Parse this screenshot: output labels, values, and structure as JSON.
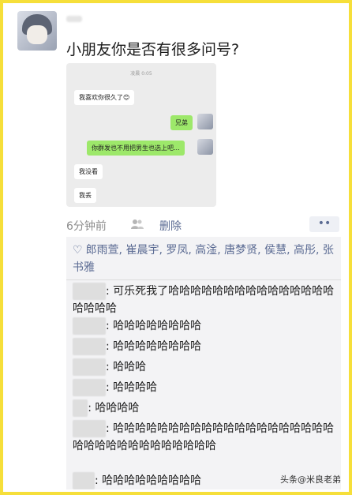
{
  "post": {
    "text": "小朋友你是否有很多问号?"
  },
  "screenshot": {
    "time": "凌晨 0:05",
    "messages": [
      {
        "side": "left",
        "text": "我喜欢你很久了😊"
      },
      {
        "side": "right",
        "text": "兄弟"
      },
      {
        "side": "right",
        "text": "你群发也不用把男生也选上吧..."
      },
      {
        "side": "left",
        "text": "我没看"
      },
      {
        "side": "left",
        "text": "我丢"
      }
    ]
  },
  "meta": {
    "time": "6分钟前",
    "delete": "删除",
    "more": "••"
  },
  "likes": {
    "names": "郎雨萱, 崔晨宇, 罗凤, 高淦, 唐梦贤, 侯慧, 高彤, 张书雅"
  },
  "comments": [
    {
      "content": "可乐死我了哈哈哈哈哈哈哈哈哈哈哈哈哈哈哈哈哈哈哈"
    },
    {
      "content": "哈哈哈哈哈哈哈哈"
    },
    {
      "content": "哈哈哈哈哈哈哈哈"
    },
    {
      "content": "哈哈哈"
    },
    {
      "content": "哈哈哈哈"
    },
    {
      "content": "哈哈哈哈"
    },
    {
      "content": "哈哈哈哈哈哈哈哈哈哈哈哈哈哈哈哈哈哈哈哈哈哈哈哈哈哈哈哈哈哈哈哈哈"
    },
    {
      "content": "哈哈哈哈哈哈哈哈哈"
    }
  ],
  "watermark": "头条@米良老弟"
}
